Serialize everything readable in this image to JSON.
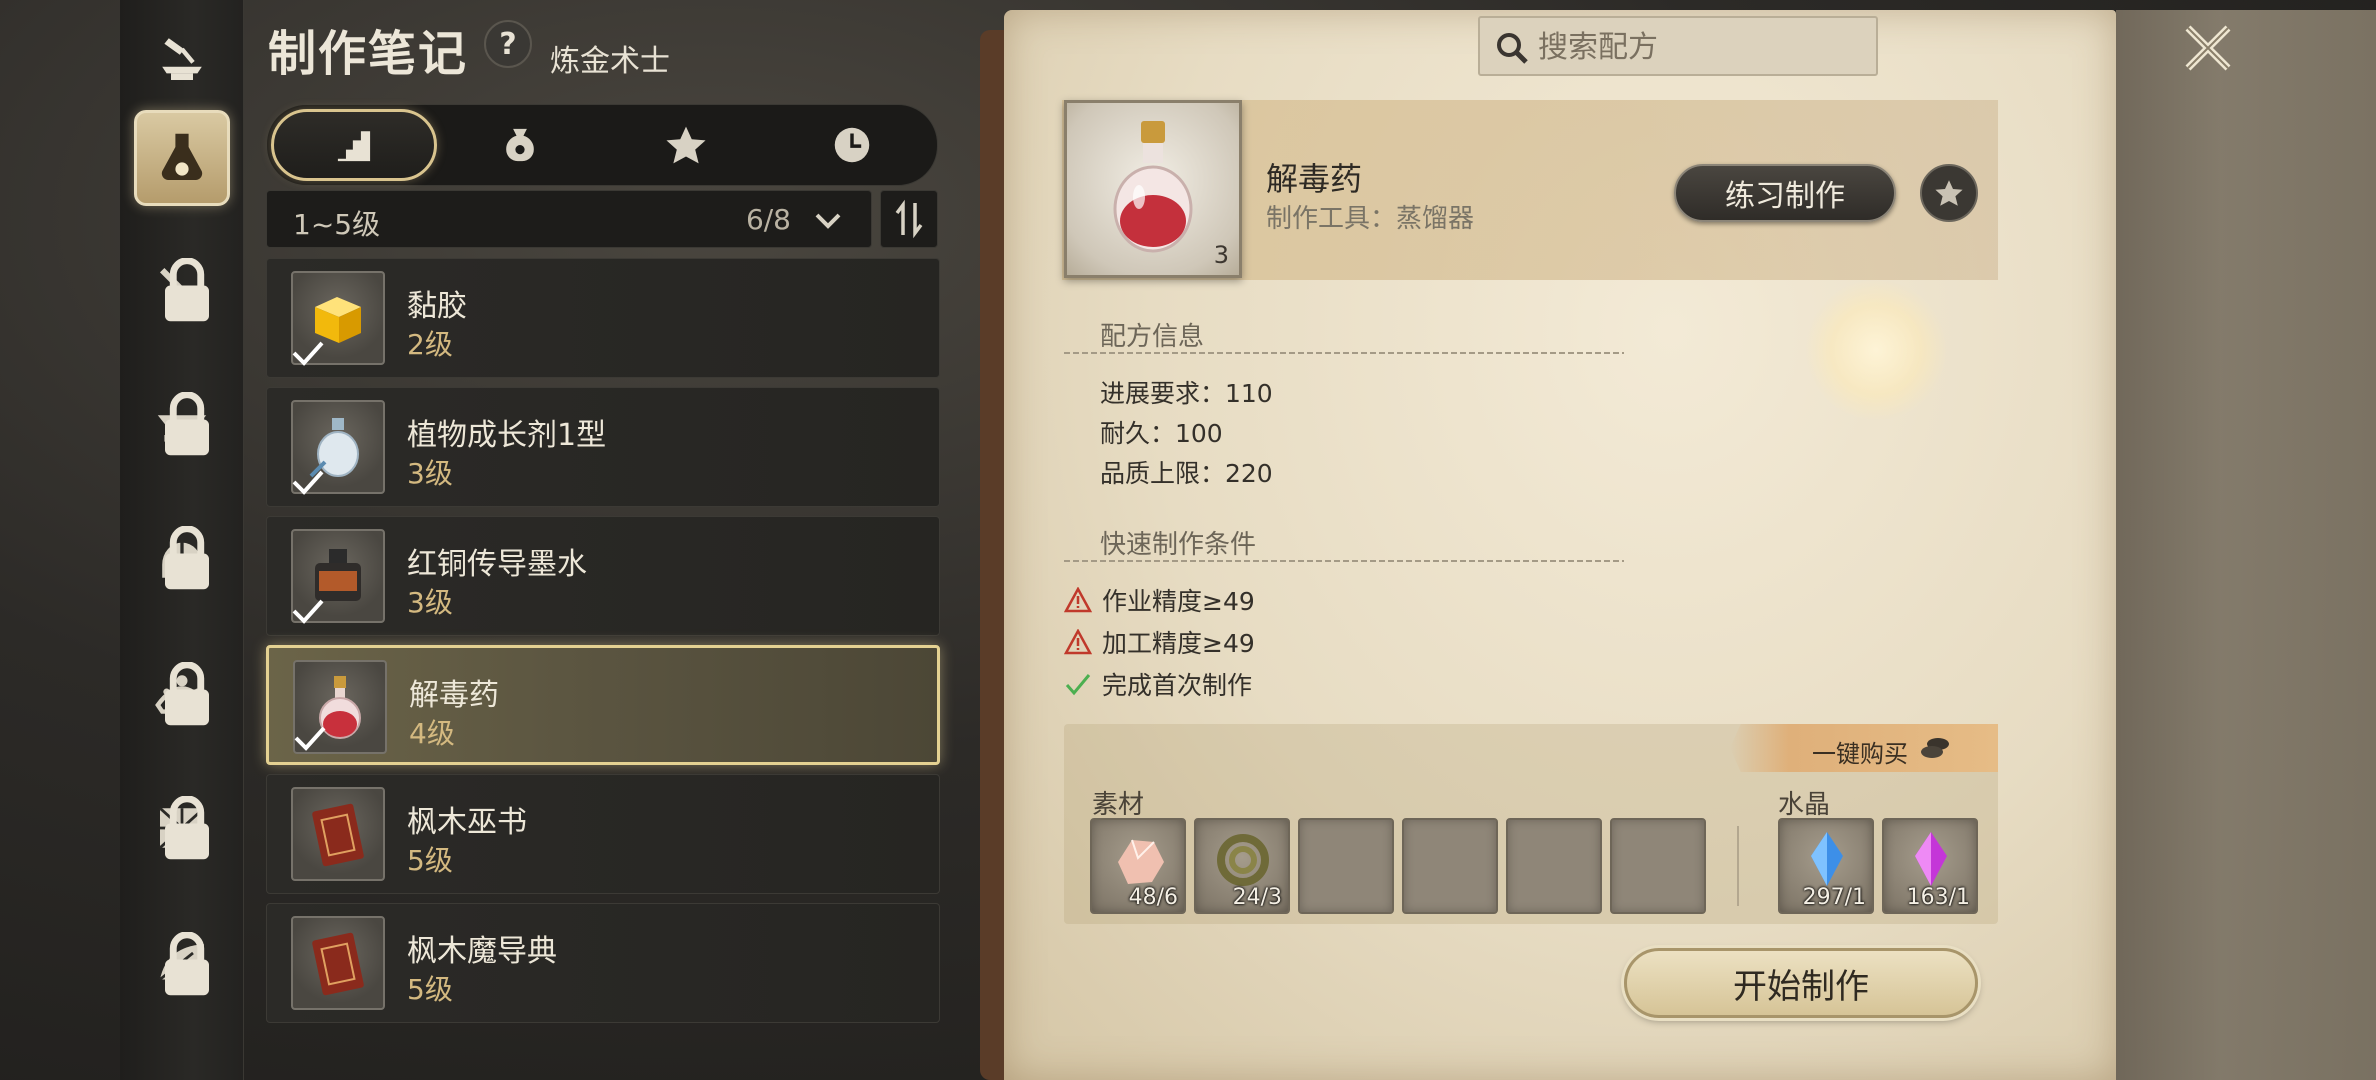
{
  "header": {
    "title": "制作笔记",
    "help": "?",
    "profession": "炼金术士"
  },
  "rail": [
    {
      "name": "hammer-anvil-icon",
      "locked": false,
      "active": false
    },
    {
      "name": "alchemy-flask-icon",
      "locked": false,
      "active": true
    },
    {
      "name": "sword-icon",
      "locked": true
    },
    {
      "name": "anvil-icon",
      "locked": true
    },
    {
      "name": "helmet-icon",
      "locked": true
    },
    {
      "name": "tiara-icon",
      "locked": true
    },
    {
      "name": "cloth-icon",
      "locked": true
    },
    {
      "name": "leaf-icon",
      "locked": true
    }
  ],
  "tabs": [
    {
      "name": "tab-level",
      "icon": "stairs-icon",
      "active": true
    },
    {
      "name": "tab-bag",
      "icon": "money-bag-icon"
    },
    {
      "name": "tab-favorite",
      "icon": "star-icon"
    },
    {
      "name": "tab-recent",
      "icon": "clock-icon"
    }
  ],
  "filter": {
    "level_range": "1~5级",
    "count": "6/8"
  },
  "recipes": [
    {
      "name": "黏胶",
      "level": "2级",
      "icon": "glue-cube-icon",
      "done": true
    },
    {
      "name": "植物成长剂1型",
      "level": "3级",
      "icon": "potion-clear-icon",
      "done": true
    },
    {
      "name": "红铜传导墨水",
      "level": "3级",
      "icon": "ink-bottle-icon",
      "done": true
    },
    {
      "name": "解毒药",
      "level": "4级",
      "icon": "potion-red-icon",
      "done": true,
      "selected": true
    },
    {
      "name": "枫木巫书",
      "level": "5级",
      "icon": "book-icon",
      "done": false
    },
    {
      "name": "枫木魔导典",
      "level": "5级",
      "icon": "book-icon",
      "done": false
    }
  ],
  "search": {
    "placeholder": "搜索配方"
  },
  "detail": {
    "item_name": "解毒药",
    "tool": "制作工具：蒸馏器",
    "quantity": "3",
    "practice_button": "练习制作",
    "recipe_info_title": "配方信息",
    "progress_req": "进展要求：110",
    "durability": "耐久：100",
    "quality_cap": "品质上限：220",
    "quick_title": "快速制作条件",
    "conditions": [
      {
        "text": "作业精度≥49",
        "status": "warning"
      },
      {
        "text": "加工精度≥49",
        "status": "warning"
      },
      {
        "text": "完成首次制作",
        "status": "ok"
      }
    ],
    "buy_all": "一键购买",
    "materials_label": "素材",
    "crystals_label": "水晶",
    "materials": [
      {
        "icon": "pink-stone-icon",
        "amount": "48/6"
      },
      {
        "icon": "coiled-snake-icon",
        "amount": "24/3"
      }
    ],
    "crystals": [
      {
        "icon": "blue-crystal-icon",
        "amount": "297/1"
      },
      {
        "icon": "purple-crystal-icon",
        "amount": "163/1"
      }
    ],
    "start_button": "开始制作"
  },
  "colors": {
    "accent_gold": "#d9c48e",
    "level_text": "#d4b980",
    "warning_red": "#c0392b",
    "ok_green": "#4caf50"
  }
}
